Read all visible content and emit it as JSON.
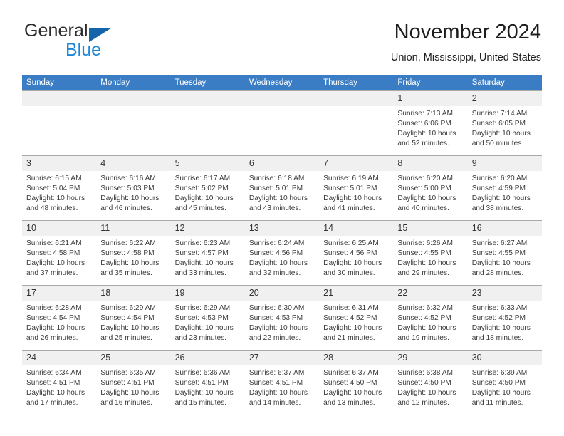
{
  "brand": {
    "name_part1": "General",
    "name_part2": "Blue",
    "triangle_color": "#1464aa",
    "blue_color": "#1a86d8"
  },
  "header": {
    "title": "November 2024",
    "subtitle": "Union, Mississippi, United States"
  },
  "theme": {
    "header_row_bg": "#3b7dc4",
    "daynum_bg": "#f0f0f0",
    "grid_line": "#a9a9a9"
  },
  "weekdays": [
    "Sunday",
    "Monday",
    "Tuesday",
    "Wednesday",
    "Thursday",
    "Friday",
    "Saturday"
  ],
  "weeks": [
    [
      {
        "day": "",
        "sunrise": "",
        "sunset": "",
        "daylight": "",
        "daylight2": ""
      },
      {
        "day": "",
        "sunrise": "",
        "sunset": "",
        "daylight": "",
        "daylight2": ""
      },
      {
        "day": "",
        "sunrise": "",
        "sunset": "",
        "daylight": "",
        "daylight2": ""
      },
      {
        "day": "",
        "sunrise": "",
        "sunset": "",
        "daylight": "",
        "daylight2": ""
      },
      {
        "day": "",
        "sunrise": "",
        "sunset": "",
        "daylight": "",
        "daylight2": ""
      },
      {
        "day": "1",
        "sunrise": "Sunrise: 7:13 AM",
        "sunset": "Sunset: 6:06 PM",
        "daylight": "Daylight: 10 hours",
        "daylight2": "and 52 minutes."
      },
      {
        "day": "2",
        "sunrise": "Sunrise: 7:14 AM",
        "sunset": "Sunset: 6:05 PM",
        "daylight": "Daylight: 10 hours",
        "daylight2": "and 50 minutes."
      }
    ],
    [
      {
        "day": "3",
        "sunrise": "Sunrise: 6:15 AM",
        "sunset": "Sunset: 5:04 PM",
        "daylight": "Daylight: 10 hours",
        "daylight2": "and 48 minutes."
      },
      {
        "day": "4",
        "sunrise": "Sunrise: 6:16 AM",
        "sunset": "Sunset: 5:03 PM",
        "daylight": "Daylight: 10 hours",
        "daylight2": "and 46 minutes."
      },
      {
        "day": "5",
        "sunrise": "Sunrise: 6:17 AM",
        "sunset": "Sunset: 5:02 PM",
        "daylight": "Daylight: 10 hours",
        "daylight2": "and 45 minutes."
      },
      {
        "day": "6",
        "sunrise": "Sunrise: 6:18 AM",
        "sunset": "Sunset: 5:01 PM",
        "daylight": "Daylight: 10 hours",
        "daylight2": "and 43 minutes."
      },
      {
        "day": "7",
        "sunrise": "Sunrise: 6:19 AM",
        "sunset": "Sunset: 5:01 PM",
        "daylight": "Daylight: 10 hours",
        "daylight2": "and 41 minutes."
      },
      {
        "day": "8",
        "sunrise": "Sunrise: 6:20 AM",
        "sunset": "Sunset: 5:00 PM",
        "daylight": "Daylight: 10 hours",
        "daylight2": "and 40 minutes."
      },
      {
        "day": "9",
        "sunrise": "Sunrise: 6:20 AM",
        "sunset": "Sunset: 4:59 PM",
        "daylight": "Daylight: 10 hours",
        "daylight2": "and 38 minutes."
      }
    ],
    [
      {
        "day": "10",
        "sunrise": "Sunrise: 6:21 AM",
        "sunset": "Sunset: 4:58 PM",
        "daylight": "Daylight: 10 hours",
        "daylight2": "and 37 minutes."
      },
      {
        "day": "11",
        "sunrise": "Sunrise: 6:22 AM",
        "sunset": "Sunset: 4:58 PM",
        "daylight": "Daylight: 10 hours",
        "daylight2": "and 35 minutes."
      },
      {
        "day": "12",
        "sunrise": "Sunrise: 6:23 AM",
        "sunset": "Sunset: 4:57 PM",
        "daylight": "Daylight: 10 hours",
        "daylight2": "and 33 minutes."
      },
      {
        "day": "13",
        "sunrise": "Sunrise: 6:24 AM",
        "sunset": "Sunset: 4:56 PM",
        "daylight": "Daylight: 10 hours",
        "daylight2": "and 32 minutes."
      },
      {
        "day": "14",
        "sunrise": "Sunrise: 6:25 AM",
        "sunset": "Sunset: 4:56 PM",
        "daylight": "Daylight: 10 hours",
        "daylight2": "and 30 minutes."
      },
      {
        "day": "15",
        "sunrise": "Sunrise: 6:26 AM",
        "sunset": "Sunset: 4:55 PM",
        "daylight": "Daylight: 10 hours",
        "daylight2": "and 29 minutes."
      },
      {
        "day": "16",
        "sunrise": "Sunrise: 6:27 AM",
        "sunset": "Sunset: 4:55 PM",
        "daylight": "Daylight: 10 hours",
        "daylight2": "and 28 minutes."
      }
    ],
    [
      {
        "day": "17",
        "sunrise": "Sunrise: 6:28 AM",
        "sunset": "Sunset: 4:54 PM",
        "daylight": "Daylight: 10 hours",
        "daylight2": "and 26 minutes."
      },
      {
        "day": "18",
        "sunrise": "Sunrise: 6:29 AM",
        "sunset": "Sunset: 4:54 PM",
        "daylight": "Daylight: 10 hours",
        "daylight2": "and 25 minutes."
      },
      {
        "day": "19",
        "sunrise": "Sunrise: 6:29 AM",
        "sunset": "Sunset: 4:53 PM",
        "daylight": "Daylight: 10 hours",
        "daylight2": "and 23 minutes."
      },
      {
        "day": "20",
        "sunrise": "Sunrise: 6:30 AM",
        "sunset": "Sunset: 4:53 PM",
        "daylight": "Daylight: 10 hours",
        "daylight2": "and 22 minutes."
      },
      {
        "day": "21",
        "sunrise": "Sunrise: 6:31 AM",
        "sunset": "Sunset: 4:52 PM",
        "daylight": "Daylight: 10 hours",
        "daylight2": "and 21 minutes."
      },
      {
        "day": "22",
        "sunrise": "Sunrise: 6:32 AM",
        "sunset": "Sunset: 4:52 PM",
        "daylight": "Daylight: 10 hours",
        "daylight2": "and 19 minutes."
      },
      {
        "day": "23",
        "sunrise": "Sunrise: 6:33 AM",
        "sunset": "Sunset: 4:52 PM",
        "daylight": "Daylight: 10 hours",
        "daylight2": "and 18 minutes."
      }
    ],
    [
      {
        "day": "24",
        "sunrise": "Sunrise: 6:34 AM",
        "sunset": "Sunset: 4:51 PM",
        "daylight": "Daylight: 10 hours",
        "daylight2": "and 17 minutes."
      },
      {
        "day": "25",
        "sunrise": "Sunrise: 6:35 AM",
        "sunset": "Sunset: 4:51 PM",
        "daylight": "Daylight: 10 hours",
        "daylight2": "and 16 minutes."
      },
      {
        "day": "26",
        "sunrise": "Sunrise: 6:36 AM",
        "sunset": "Sunset: 4:51 PM",
        "daylight": "Daylight: 10 hours",
        "daylight2": "and 15 minutes."
      },
      {
        "day": "27",
        "sunrise": "Sunrise: 6:37 AM",
        "sunset": "Sunset: 4:51 PM",
        "daylight": "Daylight: 10 hours",
        "daylight2": "and 14 minutes."
      },
      {
        "day": "28",
        "sunrise": "Sunrise: 6:37 AM",
        "sunset": "Sunset: 4:50 PM",
        "daylight": "Daylight: 10 hours",
        "daylight2": "and 13 minutes."
      },
      {
        "day": "29",
        "sunrise": "Sunrise: 6:38 AM",
        "sunset": "Sunset: 4:50 PM",
        "daylight": "Daylight: 10 hours",
        "daylight2": "and 12 minutes."
      },
      {
        "day": "30",
        "sunrise": "Sunrise: 6:39 AM",
        "sunset": "Sunset: 4:50 PM",
        "daylight": "Daylight: 10 hours",
        "daylight2": "and 11 minutes."
      }
    ]
  ]
}
